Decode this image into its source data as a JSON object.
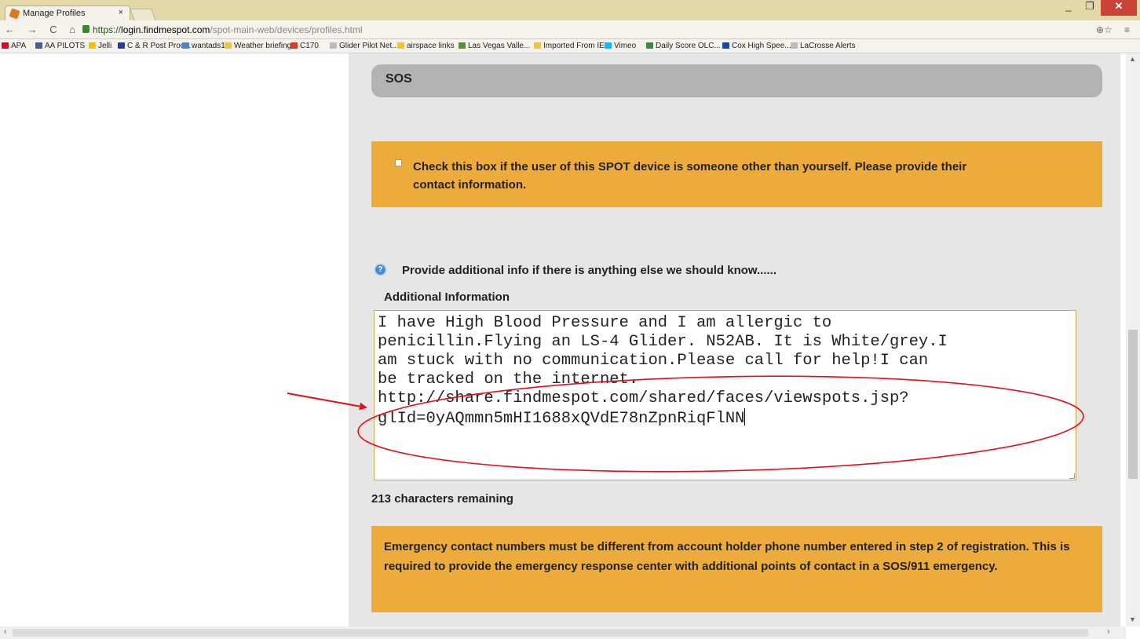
{
  "browser": {
    "tab_title": "Manage Profiles",
    "tab_close": "×",
    "url_scheme": "https://",
    "url_host": "login.findmespot.com",
    "url_path": "/spot-main-web/devices/profiles.html",
    "nav_glyphs": "← → C ⌂",
    "zoom_glyph": "⊕☆",
    "menu_glyph": "≡",
    "window_min": "_",
    "window_max": "❐",
    "window_close": "✕"
  },
  "bookmarks": [
    {
      "label": "APA",
      "color": "#c8102e"
    },
    {
      "label": "AA PILOTS",
      "color": "#4a5c9a"
    },
    {
      "label": "Jelli",
      "color": "#f2c200"
    },
    {
      "label": "C & R Post Proc...",
      "color": "#2a3f8a"
    },
    {
      "label": "wantads1",
      "color": "#4a86c5"
    },
    {
      "label": "Weather briefing",
      "color": "#e8c44a"
    },
    {
      "label": "C170",
      "color": "#d0402e"
    },
    {
      "label": "Glider Pilot Net...",
      "color": "#bbbbbb"
    },
    {
      "label": "airspace links",
      "color": "#e8c44a"
    },
    {
      "label": "Las Vegas Valle...",
      "color": "#5a8a3a"
    },
    {
      "label": "Imported From IE",
      "color": "#e8c44a"
    },
    {
      "label": "Vimeo",
      "color": "#1ab7ea"
    },
    {
      "label": "Daily Score OLC...",
      "color": "#3a8a3a"
    },
    {
      "label": "Cox High Spee...",
      "color": "#1a4a9a"
    },
    {
      "label": "LaCrosse Alerts",
      "color": "#bbbbbb"
    }
  ],
  "main": {
    "section_title": "SOS",
    "other_user_checkbox_label": "Check this box if the user of this SPOT device is someone other than yourself. Please provide their contact information.",
    "help_icon_glyph": "?",
    "additional_prompt": "Provide additional info if there is anything else we should know......",
    "additional_label": "Additional Information",
    "additional_value": "I have High Blood Pressure and I am allergic to\npenicillin.Flying an LS-4 Glider. N52AB. It is White/grey.I\nam stuck with no communication.Please call for help!I can\nbe tracked on the internet.\nhttp://share.findmespot.com/shared/faces/viewspots.jsp?\nglId=0yAQmmn5mHI1688xQVdE78nZpnRiqFlNN",
    "characters_remaining": "213 characters remaining",
    "emergency_note": "Emergency contact numbers must be different from account holder phone number entered in step 2 of registration. This is required to provide the emergency response center with additional points of contact in a SOS/911 emergency."
  },
  "colors": {
    "accent_orange": "#ecab3a",
    "annotation_red": "#e0101c",
    "header_gray": "#b3b3b3"
  }
}
